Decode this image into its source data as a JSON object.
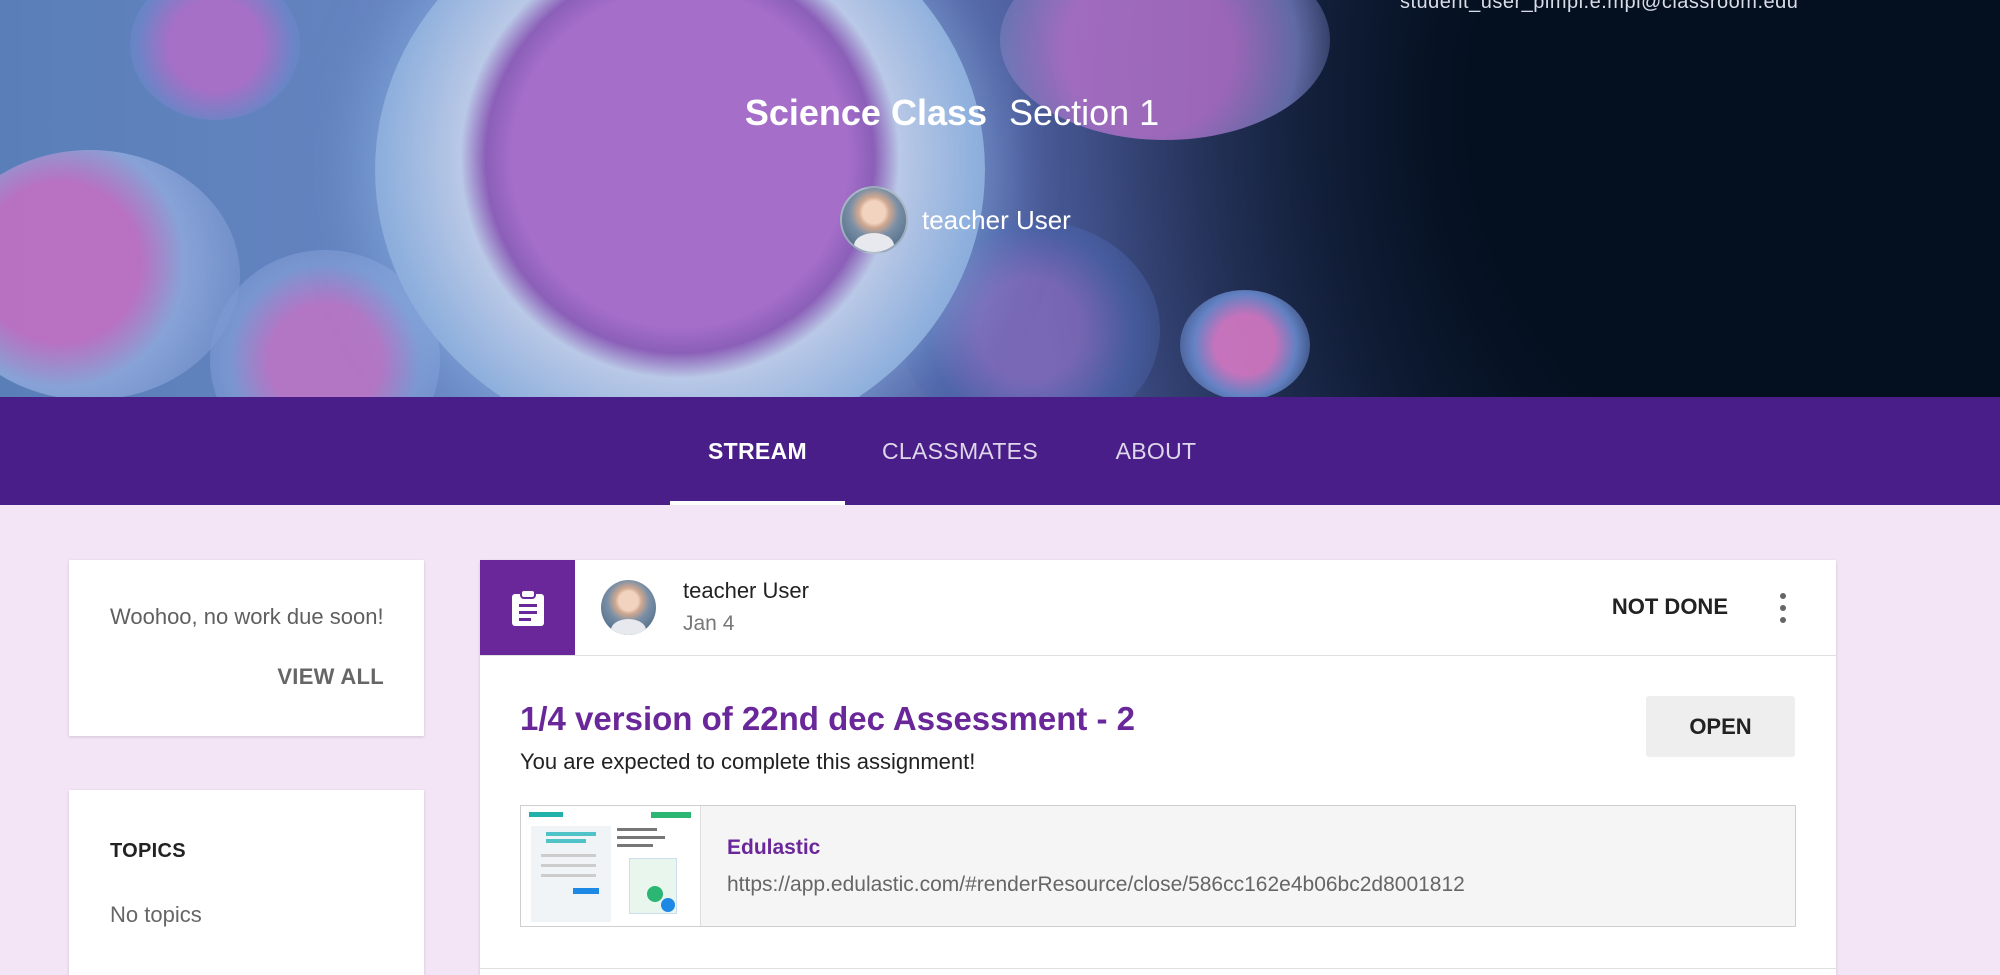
{
  "header": {
    "top_right_text": "student_user_pimpl.e.mpl@classroom.edu",
    "class_name": "Science Class",
    "section": "Section 1",
    "teacher_name": "teacher User"
  },
  "nav": {
    "tabs": [
      {
        "label": "STREAM",
        "active": true
      },
      {
        "label": "CLASSMATES",
        "active": false
      },
      {
        "label": "ABOUT",
        "active": false
      }
    ]
  },
  "upcoming": {
    "message": "Woohoo, no work due soon!",
    "view_all": "VIEW ALL"
  },
  "topics": {
    "heading": "TOPICS",
    "empty": "No topics"
  },
  "post": {
    "author": "teacher User",
    "date": "Jan 4",
    "status": "NOT DONE",
    "title": "1/4 version of 22nd dec Assessment - 2",
    "description": "You are expected to complete this assignment!",
    "open_label": "OPEN",
    "attachment": {
      "name": "Edulastic",
      "url": "https://app.edulastic.com/#renderResource/close/586cc162e4b06bc2d8001812"
    }
  },
  "colors": {
    "nav_bg": "#4a1e88",
    "accent_purple": "#6a2799",
    "page_bg": "#f3e5f5"
  }
}
